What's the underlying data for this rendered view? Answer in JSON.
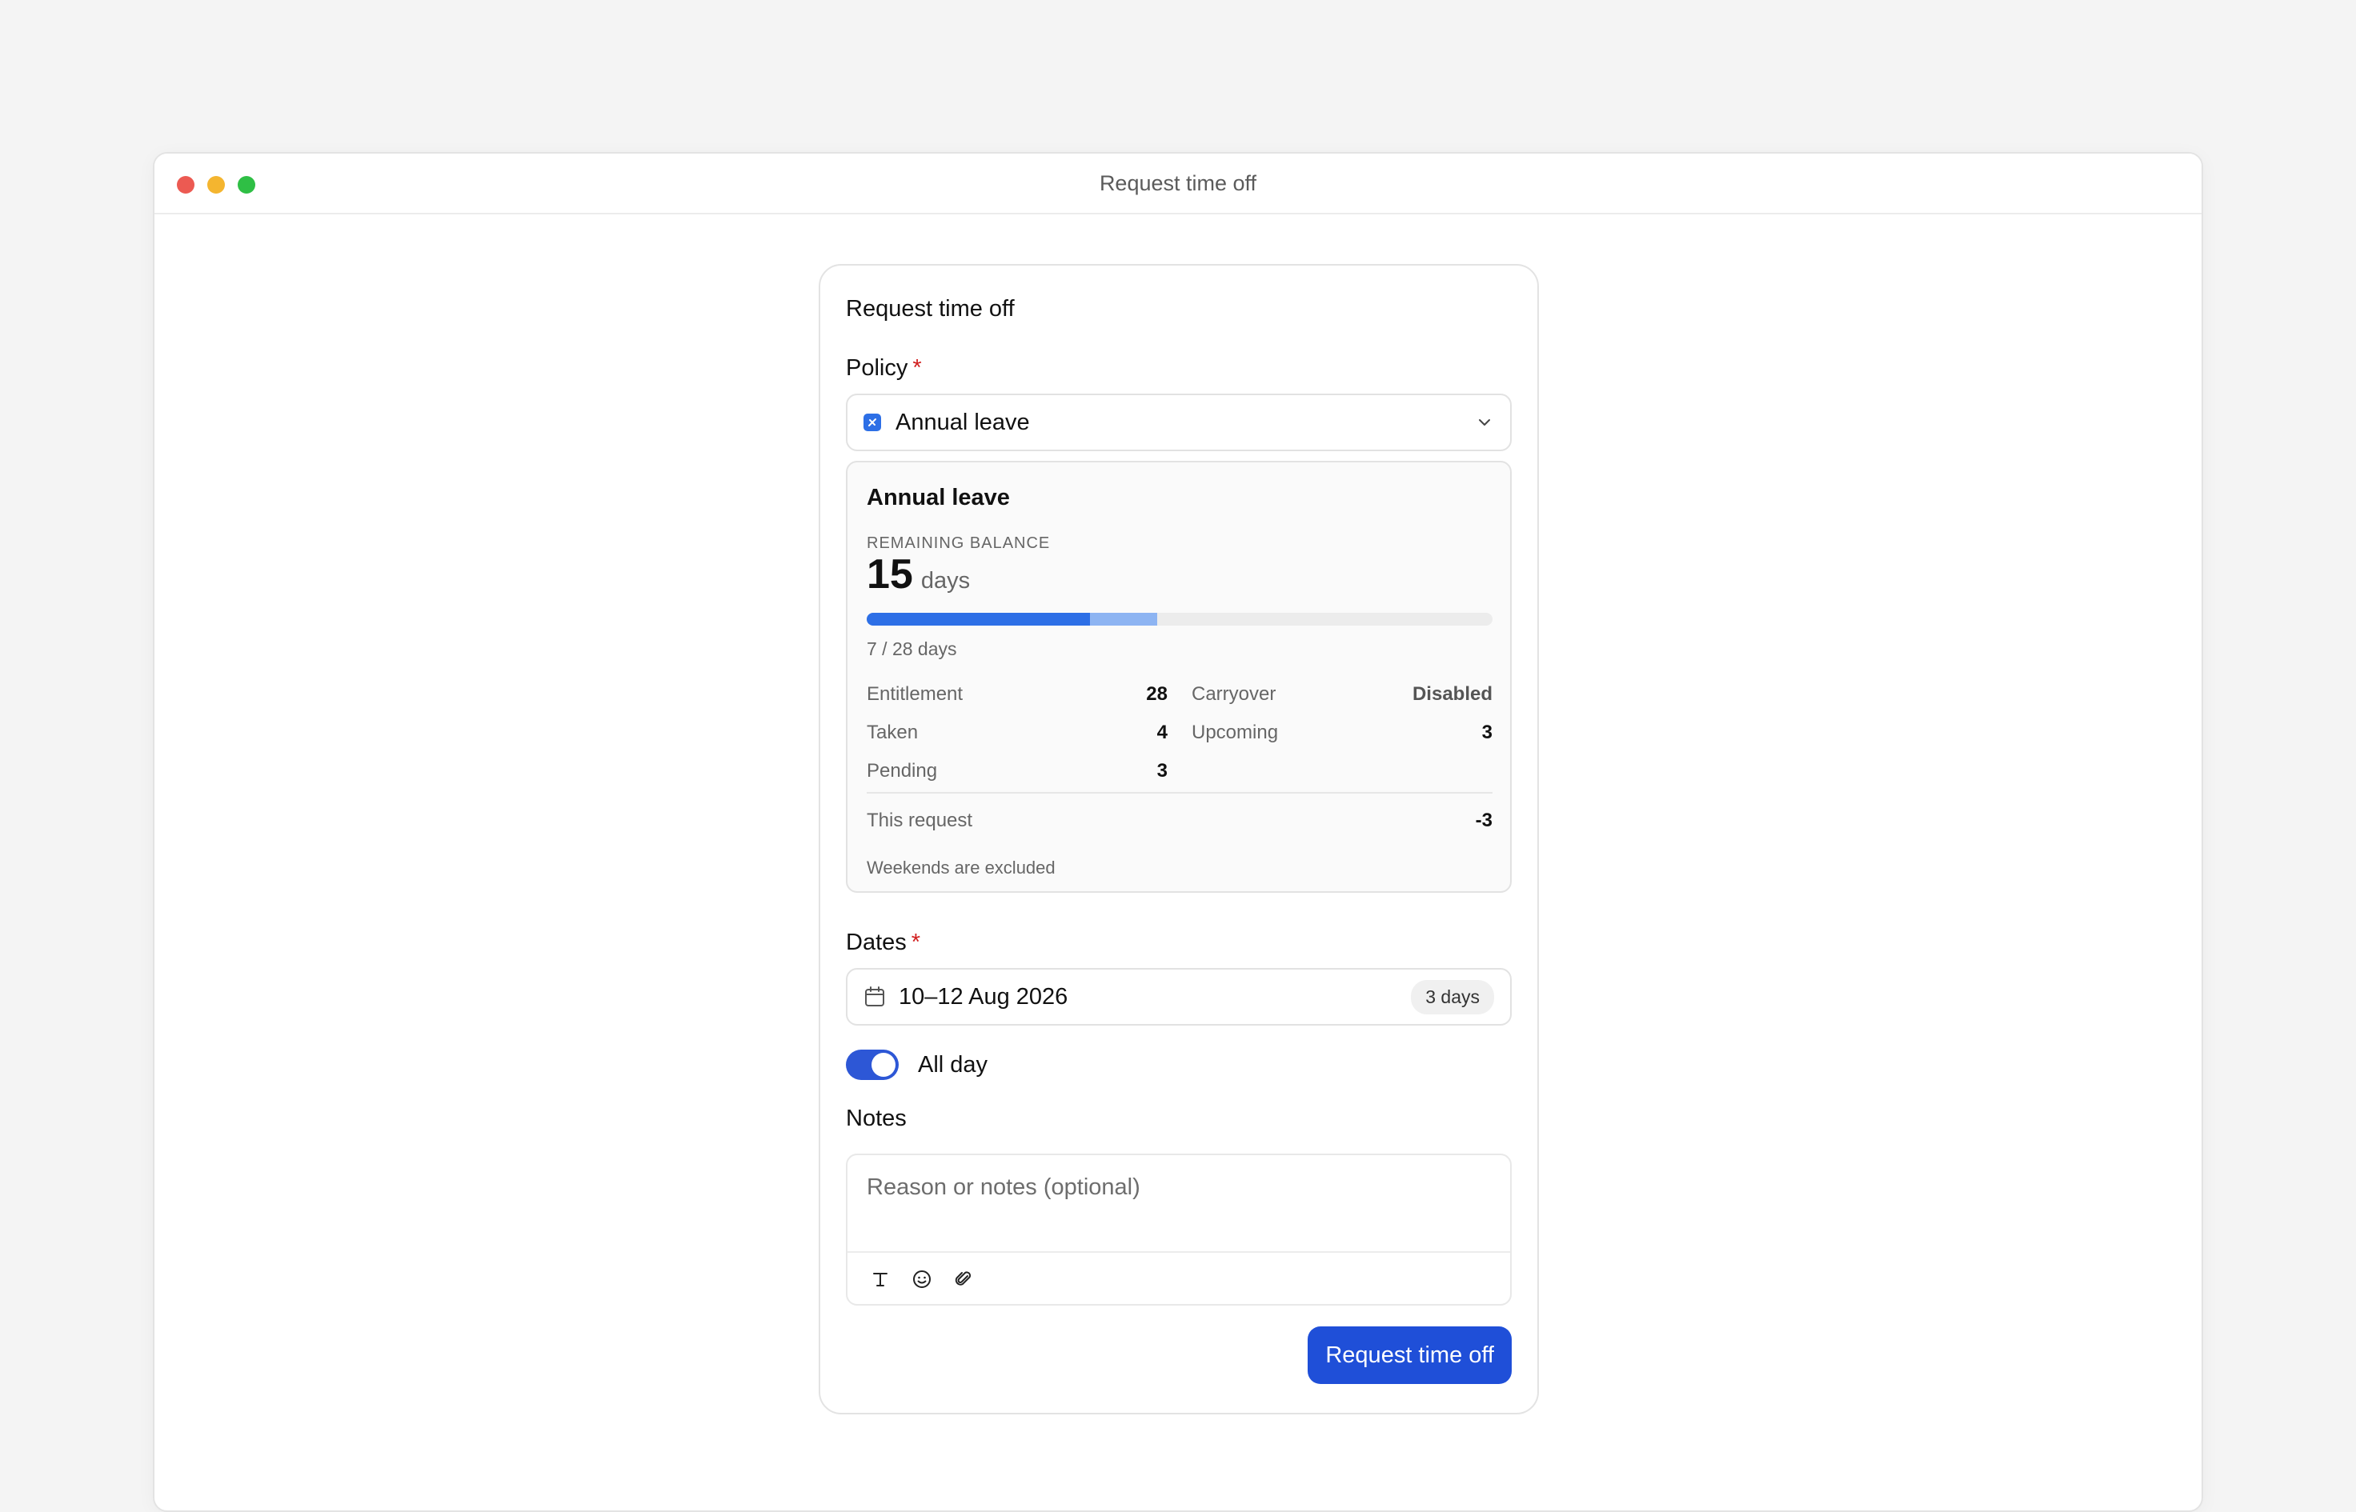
{
  "window": {
    "title": "Request time off"
  },
  "form": {
    "title": "Request time off",
    "policy": {
      "label": "Policy",
      "required_mark": "*",
      "value": "Annual leave"
    },
    "balance": {
      "name": "Annual leave",
      "caption": "REMAINING BALANCE",
      "remaining": "15",
      "unit": "days",
      "used_fraction": 0.357,
      "pending_fraction": 0.107,
      "progress_text": "7 / 28 days",
      "stats": {
        "entitlement": {
          "label": "Entitlement",
          "value": "28"
        },
        "carryover": {
          "label": "Carryover",
          "value": "Disabled"
        },
        "taken": {
          "label": "Taken",
          "value": "4"
        },
        "upcoming": {
          "label": "Upcoming",
          "value": "3"
        },
        "pending": {
          "label": "Pending",
          "value": "3"
        }
      },
      "this_request": {
        "label": "This request",
        "value": "-3"
      },
      "note": "Weekends are excluded"
    },
    "dates": {
      "label": "Dates",
      "required_mark": "*",
      "value": "10–12 Aug 2026",
      "duration": "3 days"
    },
    "all_day": {
      "label": "All day",
      "on": true
    },
    "notes": {
      "label": "Notes",
      "placeholder": "Reason or notes (optional)"
    },
    "submit_label": "Request time off"
  },
  "colors": {
    "accent": "#2d6fe6",
    "button": "#1f4fd8",
    "required": "#d11f1f"
  },
  "icons": [
    "policy-icon",
    "chevron-down-icon",
    "calendar-icon",
    "text-format-icon",
    "emoji-icon",
    "attachment-icon"
  ]
}
